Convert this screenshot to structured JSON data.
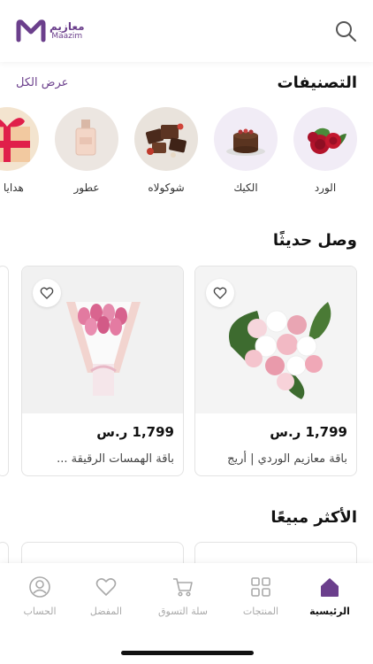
{
  "header": {
    "logo_ar": "معازيم",
    "logo_en": "Maazim",
    "search_icon": "search-icon"
  },
  "categories": {
    "title": "التصنيفات",
    "view_all": "عرض الكل",
    "items": [
      {
        "label": "الورد",
        "icon": "roses"
      },
      {
        "label": "الكيك",
        "icon": "cake"
      },
      {
        "label": "شوكولاه",
        "icon": "chocolate"
      },
      {
        "label": "عطور",
        "icon": "perfume"
      },
      {
        "label": "هدايا للا",
        "icon": "gift"
      }
    ]
  },
  "new_arrivals": {
    "title": "وصل حديثًا",
    "products": [
      {
        "price": "1,799 ر.س",
        "name": "باقة معازيم الوردي | أريج"
      },
      {
        "price": "1,799 ر.س",
        "name": "باقة الهمسات الرقيقة ..."
      }
    ]
  },
  "best_sellers": {
    "title": "الأكثر مبيعًا"
  },
  "bottom_nav": {
    "items": [
      {
        "label": "الرئيسية",
        "icon": "home-icon",
        "active": true
      },
      {
        "label": "المنتجات",
        "icon": "grid-icon",
        "active": false
      },
      {
        "label": "سلة التسوق",
        "icon": "cart-icon",
        "active": false
      },
      {
        "label": "المفضل",
        "icon": "heart-icon",
        "active": false
      },
      {
        "label": "الحساب",
        "icon": "user-icon",
        "active": false
      }
    ]
  },
  "colors": {
    "accent": "#6b3f8c",
    "inactive": "#a9a9a9",
    "category_bg": "#f1ecf6"
  }
}
